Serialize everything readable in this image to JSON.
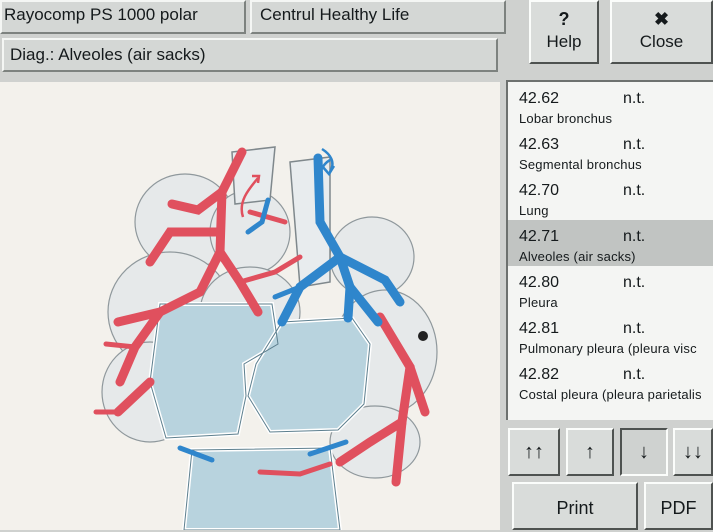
{
  "header": {
    "app_title": "Rayocomp PS 1000 polar",
    "client": "Centrul Healthy Life"
  },
  "diagnosis": {
    "label": "Diag.: Alveoles (air sacks)"
  },
  "buttons": {
    "help": {
      "symbol": "?",
      "label": "Help"
    },
    "close": {
      "symbol": "✖",
      "label": "Close"
    },
    "print": "Print",
    "pdf": "PDF"
  },
  "nav": {
    "first": "↑↑",
    "up": "↑",
    "down": "↓",
    "last": "↓↓"
  },
  "list": [
    {
      "value": "42.62",
      "status": "n.t.",
      "name": "Lobar bronchus",
      "selected": false
    },
    {
      "value": "42.63",
      "status": "n.t.",
      "name": "Segmental bronchus",
      "selected": false
    },
    {
      "value": "42.70",
      "status": "n.t.",
      "name": "Lung",
      "selected": false
    },
    {
      "value": "42.71",
      "status": "n.t.",
      "name": "Alveoles (air sacks)",
      "selected": true
    },
    {
      "value": "42.80",
      "status": "n.t.",
      "name": "Pleura",
      "selected": false
    },
    {
      "value": "42.81",
      "status": "n.t.",
      "name": "Pulmonary pleura (pleura visc",
      "selected": false
    },
    {
      "value": "42.82",
      "status": "n.t.",
      "name": "Costal pleura (pleura parietalis",
      "selected": false
    }
  ],
  "colors": {
    "artery": "#e0505e",
    "vein": "#2f86cc",
    "alveoli": "#b8d3de"
  }
}
